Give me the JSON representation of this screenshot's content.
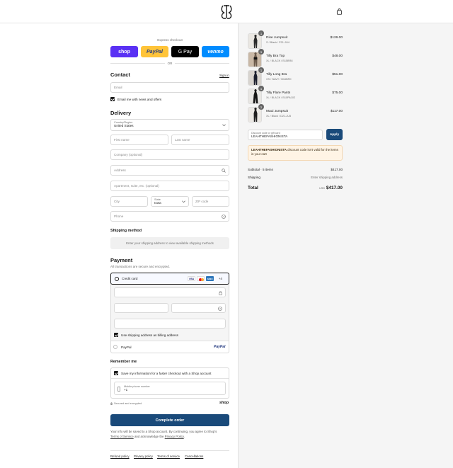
{
  "header": {
    "logo_icon": "brand-logo-icon",
    "cart_icon": "shopping-bag-icon"
  },
  "express": {
    "title": "Express checkout",
    "buttons": [
      {
        "label": "shop",
        "color": "#5a31f4"
      },
      {
        "label": "PayPal",
        "color": "#ffc439"
      },
      {
        "label": "G Pay",
        "color": "#000000"
      },
      {
        "label": "venmo",
        "color": "#008cff"
      }
    ],
    "or": "OR"
  },
  "contact": {
    "title": "Contact",
    "sign_in": "Sign in",
    "email_placeholder": "Email",
    "news_label": "Email me with news and offers"
  },
  "delivery": {
    "title": "Delivery",
    "country_label": "Country/Region",
    "country_value": "United States",
    "first_name": "First name",
    "last_name": "Last name",
    "company": "Company (optional)",
    "address": "Address",
    "apartment": "Apartment, suite, etc. (optional)",
    "city": "City",
    "state_label": "State",
    "state_value": "Iowa",
    "zip": "ZIP code",
    "phone": "Phone"
  },
  "shipping": {
    "title": "Shipping method",
    "message": "Enter your shipping address to view available shipping methods"
  },
  "payment": {
    "title": "Payment",
    "subtitle": "All transactions are secure and encrypted.",
    "credit_card": "Credit card",
    "card_brands": [
      "VISA",
      "MC",
      "AMEX"
    ],
    "more": "+4",
    "billing_label": "Use shipping address as billing address",
    "paypal": "PayPal"
  },
  "remember": {
    "title": "Remember me",
    "save_label": "Save my information for a faster checkout with a Shop account",
    "mobile_label": "Mobile phone number",
    "mobile_value": "+1",
    "secure": "Secured and encrypted",
    "shop": "shop"
  },
  "complete": {
    "button": "Complete order",
    "note_1": "Your info will be saved to a Shop account. By continuing, you agree to Shop's",
    "terms": "Terms of Service",
    "note_2": "and acknowledge the",
    "privacy": "Privacy Policy",
    "note_end": "."
  },
  "footer": {
    "links": [
      "Refund policy",
      "Privacy policy",
      "Terms of service",
      "Cancellations"
    ]
  },
  "cart": {
    "items": [
      {
        "qty": "1",
        "name": "Rise Jumpsuit",
        "variant": "S / Black / P21-JU4",
        "price": "$126.00"
      },
      {
        "qty": "1",
        "name": "Tilly Bra Top",
        "variant": "XL / BLACK / B15BR8",
        "price": "$48.00"
      },
      {
        "qty": "1",
        "name": "Tilly Long Bra",
        "variant": "XS / NAVY / B16BR0",
        "price": "$51.00"
      },
      {
        "qty": "1",
        "name": "Tilly Flare Pants",
        "variant": "XL / BLACK / B10PA102",
        "price": "$75.00"
      },
      {
        "qty": "1",
        "name": "Maui Jumpsuit",
        "variant": "XL / Black / D21-JU5",
        "price": "$117.00"
      }
    ],
    "discount_label": "Discount code or gift card",
    "discount_value": "LEAHTHEFASHIONISTA",
    "apply": "Apply",
    "error_code": "LEAHTHEFASHIONISTA",
    "error_msg": "discount code isn't valid for the items in your cart",
    "subtotal_label": "Subtotal · 5 items",
    "subtotal_value": "$417.00",
    "shipping_label": "Shipping",
    "shipping_value": "Enter shipping address",
    "total_label": "Total",
    "currency": "USD",
    "total_value": "$417.00"
  },
  "colors": {
    "accent": "#1a4a7a",
    "error_bg": "#fff4e5"
  }
}
